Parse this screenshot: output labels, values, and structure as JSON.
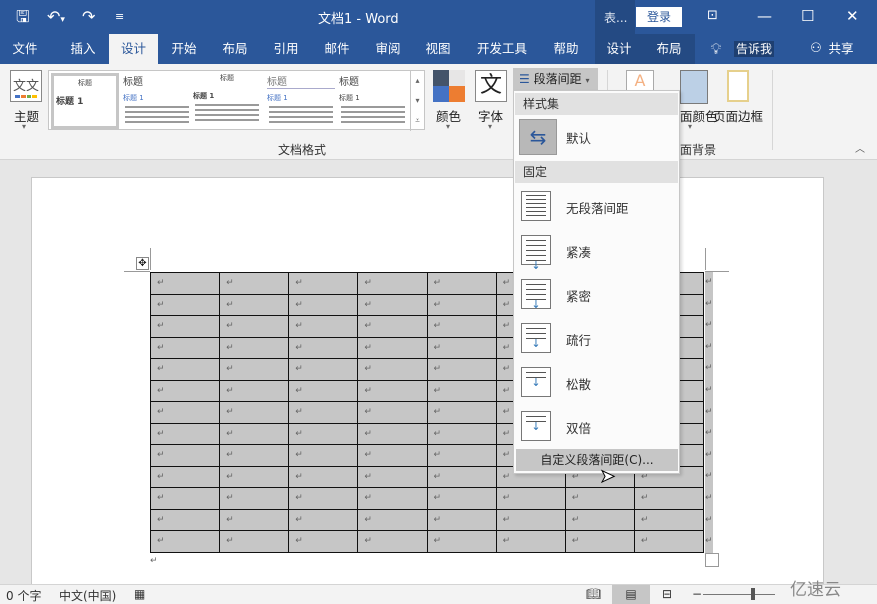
{
  "titlebar": {
    "title": "文档1  -  Word",
    "context_group": "表...",
    "login": "登录"
  },
  "quick_access": {
    "save": "save-icon",
    "undo": "undo-icon",
    "redo": "redo-icon",
    "customize": "customize-icon"
  },
  "tabs": [
    {
      "label": "文件"
    },
    {
      "label": "插入"
    },
    {
      "label": "设计",
      "active": true
    },
    {
      "label": "开始"
    },
    {
      "label": "布局"
    },
    {
      "label": "引用"
    },
    {
      "label": "邮件"
    },
    {
      "label": "审阅"
    },
    {
      "label": "视图"
    },
    {
      "label": "开发工具"
    },
    {
      "label": "帮助"
    },
    {
      "label": "设计"
    },
    {
      "label": "布局"
    }
  ],
  "tell_me": "告诉我",
  "share": "共享",
  "ribbon": {
    "theme": "主题",
    "gallery_items": [
      {
        "heading": "标题",
        "sub": "标题 1"
      },
      {
        "heading": "标题",
        "sub": "标题 1"
      },
      {
        "heading": "标题",
        "sub": "标题 1"
      },
      {
        "heading": "标题",
        "sub": "标题 1"
      },
      {
        "heading": "标题",
        "sub": "标题 1"
      }
    ],
    "group_doc_format": "文档格式",
    "colors": "颜色",
    "fonts": "字体",
    "paragraph_spacing": "段落间距",
    "watermark": "水印",
    "page_color": "页面颜色",
    "page_border": "页面边框",
    "page_color_visible": "面颜色",
    "group_page_bg_visible": "面背景",
    "accent_colors": [
      "#44546a",
      "#e7e6e6",
      "#4472c4",
      "#ed7d31"
    ]
  },
  "menu": {
    "section_style_set": "样式集",
    "default": "默认",
    "section_fixed": "固定",
    "items": [
      {
        "label": "无段落间距",
        "icon": "no-spacing-icon"
      },
      {
        "label": "紧凑",
        "icon": "compact-spacing-icon"
      },
      {
        "label": "紧密",
        "icon": "tight-spacing-icon"
      },
      {
        "label": "疏行",
        "icon": "open-spacing-icon"
      },
      {
        "label": "松散",
        "icon": "relaxed-spacing-icon"
      },
      {
        "label": "双倍",
        "icon": "double-spacing-icon"
      }
    ],
    "custom": "自定义段落间距(C)..."
  },
  "table": {
    "rows": 13,
    "cols": 8,
    "cell_mark": "↵"
  },
  "status": {
    "word_count": "0 个字",
    "language": "中文(中国)"
  },
  "watermark_brand": "亿速云"
}
